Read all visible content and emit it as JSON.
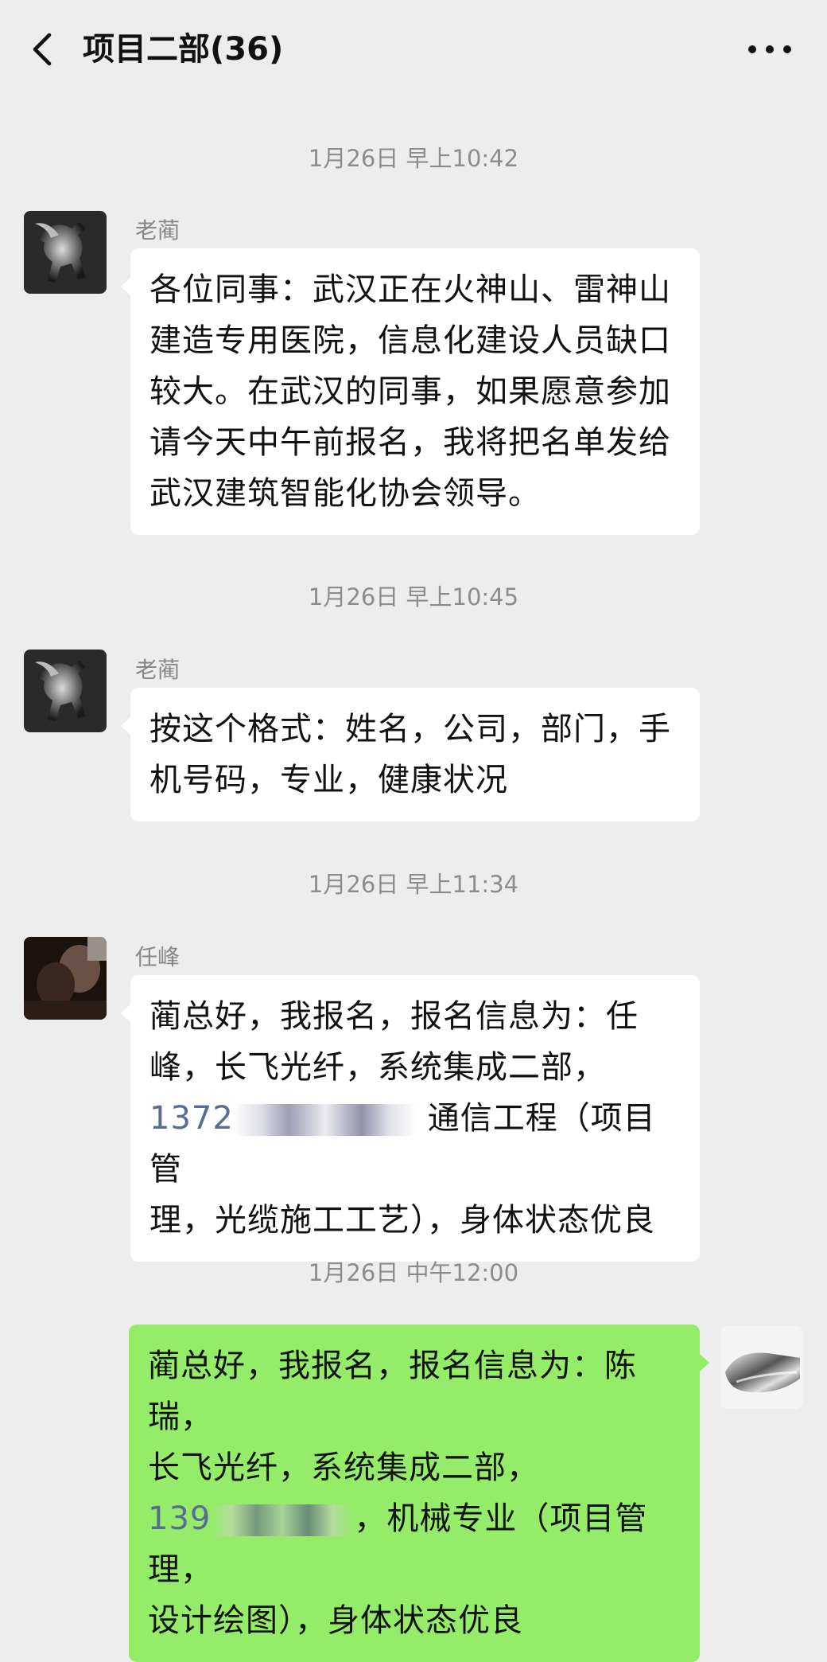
{
  "header": {
    "title": "项目二部(36)",
    "back_icon": "chevron-left-icon",
    "more_icon": "more-horizontal-icon"
  },
  "colors": {
    "background": "#ededed",
    "self_bubble": "#95ec69",
    "other_bubble": "#ffffff",
    "phone_link": "#576b95"
  },
  "messages": [
    {
      "time": "1月26日 早上10:42",
      "sender": "老蔺",
      "text": "各位同事：武汉正在火神山、雷神山建造专用医院，信息化建设人员缺口较大。在武汉的同事，如果愿意参加请今天中午前报名，我将把名单发给武汉建筑智能化协会领导。"
    },
    {
      "time": "1月26日 早上10:45",
      "sender": "老蔺",
      "text": "按这个格式：姓名，公司，部门，手机号码，专业，健康状况"
    },
    {
      "time": "1月26日 早上11:34",
      "sender": "任峰",
      "line1": "蔺总好，我报名，报名信息为：任",
      "line2": "峰，长飞光纤，系统集成二部，",
      "phone": "1372",
      "after_phone": "通信工程（项目管",
      "line4": "理，光缆施工工艺），身体状态优良"
    },
    {
      "time": "1月26日 中午12:00",
      "sender": "me",
      "line1": "蔺总好，我报名，报名信息为：陈瑞，",
      "line2": "长飞光纤，系统集成二部，",
      "phone": "139",
      "after_phone": "，机械专业（项目管理，",
      "line4": "设计绘图），身体状态优良"
    }
  ]
}
